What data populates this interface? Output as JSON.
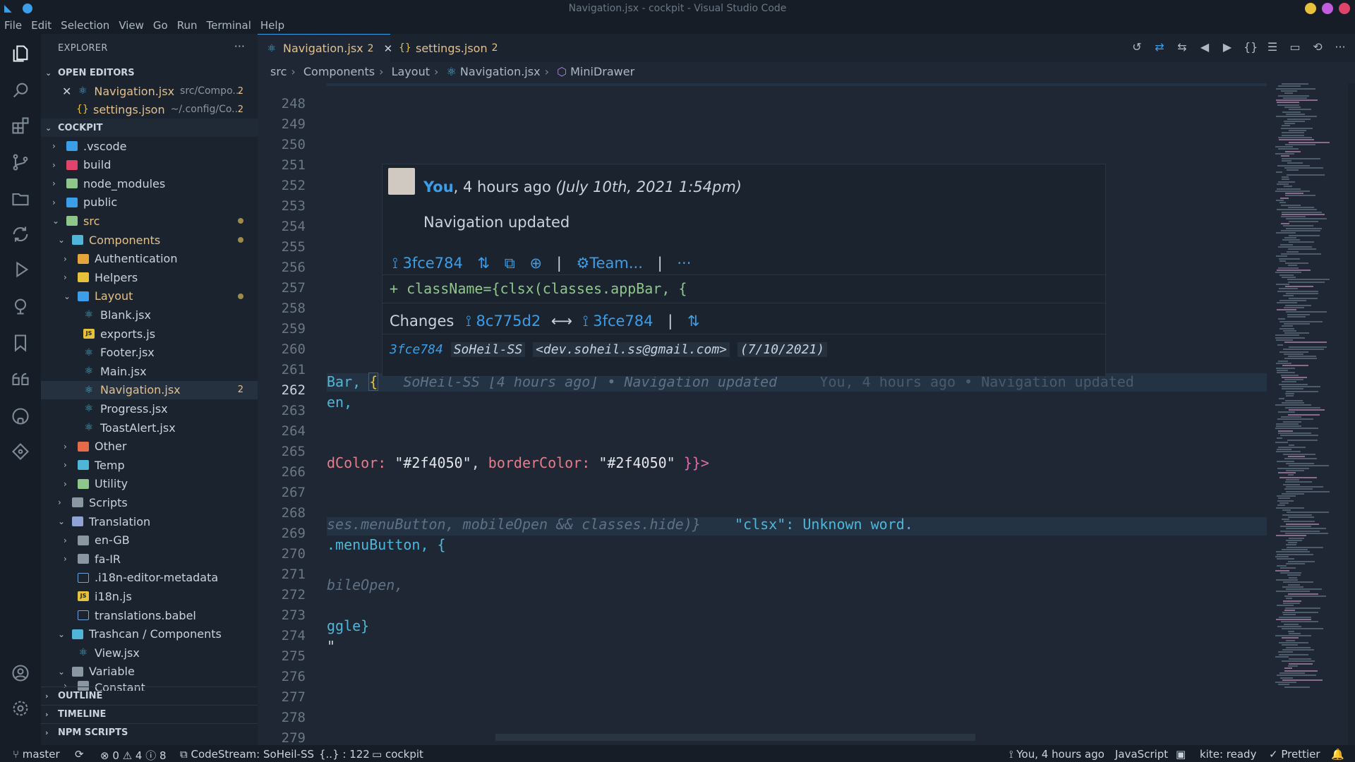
{
  "window": {
    "title": "Navigation.jsx - cockpit - Visual Studio Code"
  },
  "menu": [
    "File",
    "Edit",
    "Selection",
    "View",
    "Go",
    "Run",
    "Terminal",
    "Help"
  ],
  "explorer": {
    "title": "EXPLORER",
    "open_editors_label": "OPEN EDITORS",
    "open_editors": [
      {
        "name": "Navigation.jsx",
        "desc": "src/Compo...",
        "badge": "2"
      },
      {
        "name": "settings.json",
        "desc": "~/.config/Co...",
        "badge": "2"
      }
    ],
    "root_label": "COCKPIT",
    "tree": [
      {
        "name": ".vscode"
      },
      {
        "name": "build"
      },
      {
        "name": "node_modules"
      },
      {
        "name": "public"
      },
      {
        "name": "src"
      },
      {
        "name": "Components"
      },
      {
        "name": "Authentication"
      },
      {
        "name": "Helpers"
      },
      {
        "name": "Layout"
      },
      {
        "name": "Blank.jsx"
      },
      {
        "name": "exports.js"
      },
      {
        "name": "Footer.jsx"
      },
      {
        "name": "Main.jsx"
      },
      {
        "name": "Navigation.jsx",
        "badge": "2"
      },
      {
        "name": "Progress.jsx"
      },
      {
        "name": "ToastAlert.jsx"
      },
      {
        "name": "Other"
      },
      {
        "name": "Temp"
      },
      {
        "name": "Utility"
      },
      {
        "name": "Scripts"
      },
      {
        "name": "Translation"
      },
      {
        "name": "en-GB"
      },
      {
        "name": "fa-IR"
      },
      {
        "name": ".i18n-editor-metadata"
      },
      {
        "name": "i18n.js"
      },
      {
        "name": "translations.babel"
      },
      {
        "name": "Trashcan / Components"
      },
      {
        "name": "View.jsx"
      },
      {
        "name": "Variable"
      },
      {
        "name": "Constant"
      }
    ],
    "outline_label": "OUTLINE",
    "timeline_label": "TIMELINE",
    "npm_label": "NPM SCRIPTS"
  },
  "tabs": [
    {
      "name": "Navigation.jsx",
      "badge": "2"
    },
    {
      "name": "settings.json",
      "badge": "2"
    }
  ],
  "breadcrumb": [
    "src",
    "Components",
    "Layout",
    "Navigation.jsx",
    "MiniDrawer"
  ],
  "line_numbers": [
    "248",
    "249",
    "250",
    "251",
    "252",
    "253",
    "254",
    "255",
    "256",
    "257",
    "258",
    "259",
    "260",
    "261",
    "262",
    "263",
    "264",
    "265",
    "266",
    "267",
    "268",
    "269",
    "270",
    "271",
    "272",
    "273",
    "274",
    "275",
    "276",
    "277",
    "278",
    "279"
  ],
  "code": {
    "l262a": "Bar, ",
    "l262b": "{",
    "l262_blame": "SoHeil-SS [4 hours ago] • Navigation updated",
    "l262_blame2": "You, 4 hours ago • Navigation updated",
    "l263": "en,",
    "l266_a": "dColor: ",
    "l266_b": "\"#2f4050\"",
    "l266_c": ", ",
    "l266_d": "borderColor: ",
    "l266_e": "\"#2f4050\"",
    "l266_f": " }}>",
    "l269_a": "ses.menuButton, mobileOpen && classes.hide)}",
    "l269_b": "\"clsx\": Unknown word.",
    "l270": ".menuButton, {",
    "l272": "bileOpen,",
    "l275": "ggle}",
    "l276": "\""
  },
  "hover": {
    "author": "You",
    "when": ", 4 hours ago",
    "date": "(July 10th, 2021 1:54pm)",
    "message": "Navigation updated",
    "sha": "3fce784",
    "team": "Team...",
    "diff_line": "+ className={clsx(classes.appBar, {",
    "changes_label": "Changes",
    "from_sha": "8c775d2",
    "arrow": "⟷",
    "to_sha": "3fce784",
    "footer_sha": "3fce784",
    "footer_author": "SoHeil-SS",
    "footer_email": "<dev.soheil.ss@gmail.com>",
    "footer_date": "(7/10/2021)"
  },
  "status": {
    "branch": "master",
    "errors": "0",
    "warnings": "4",
    "info": "8",
    "codestream": "CodeStream: SoHeil-SS",
    "json_pos": "{..} : 122",
    "project": "cockpit",
    "blame": "You, 4 hours ago",
    "language": "JavaScript",
    "kite": "kite: ready",
    "prettier": "Prettier"
  },
  "colors": {
    "accent": "#3b9ee8",
    "modified": "#e2c08d",
    "background": "#1e2733",
    "sidebar": "#1b232e"
  }
}
